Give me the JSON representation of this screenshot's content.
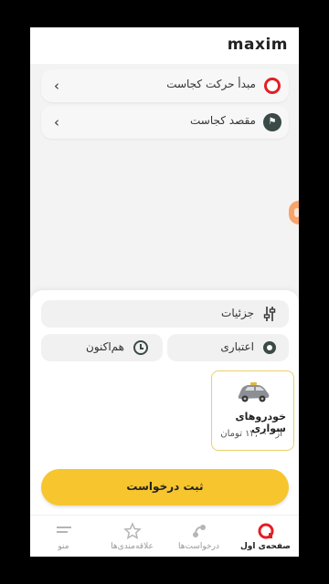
{
  "header": {
    "logo_text": "maxim"
  },
  "route": {
    "origin_label": "مبدأ حرکت کجاست",
    "destination_label": "مقصد کجاست",
    "chevron": "‹"
  },
  "order": {
    "details_label": "جزئیات",
    "payment_label": "اعتباری",
    "time_label": "هم‌اکنون",
    "tariff": {
      "name": "خودروهای سواری",
      "price": "از ۱۲,۰۰۰ تومان"
    },
    "submit_label": "ثبت درخواست"
  },
  "nav": {
    "items": [
      {
        "label": "صفحه‌ی اول",
        "icon": "home-icon"
      },
      {
        "label": "درخواست‌ها",
        "icon": "orders-icon"
      },
      {
        "label": "علاقه‌مندی‌ها",
        "icon": "star-icon"
      },
      {
        "label": "منو",
        "icon": "menu-icon"
      }
    ]
  },
  "colors": {
    "brand": "#e31e24",
    "accent": "#f7c52e",
    "dark": "#3a4a46"
  }
}
